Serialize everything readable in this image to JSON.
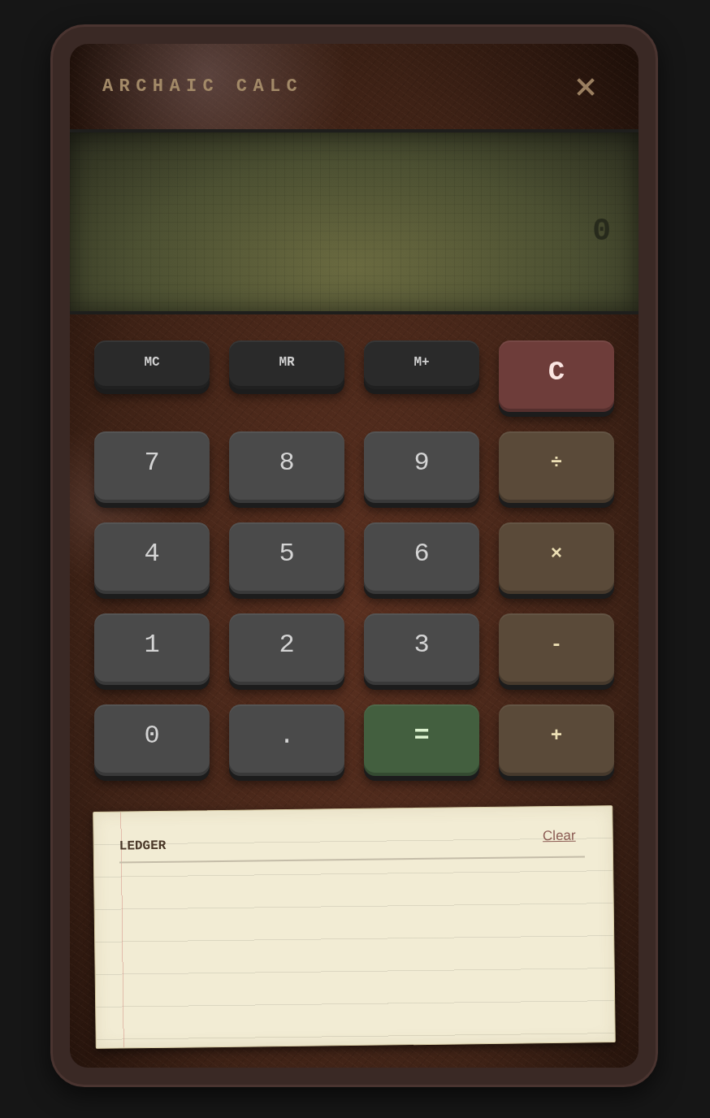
{
  "window": {
    "title": "ARCHAIC CALC"
  },
  "display": {
    "value": "0"
  },
  "keys": [
    {
      "label": "MC",
      "kind": "memory"
    },
    {
      "label": "MR",
      "kind": "memory"
    },
    {
      "label": "M+",
      "kind": "memory"
    },
    {
      "label": "C",
      "kind": "clear"
    },
    {
      "label": "7",
      "kind": "digit"
    },
    {
      "label": "8",
      "kind": "digit"
    },
    {
      "label": "9",
      "kind": "digit"
    },
    {
      "label": "÷",
      "kind": "operator"
    },
    {
      "label": "4",
      "kind": "digit"
    },
    {
      "label": "5",
      "kind": "digit"
    },
    {
      "label": "6",
      "kind": "digit"
    },
    {
      "label": "×",
      "kind": "operator"
    },
    {
      "label": "1",
      "kind": "digit"
    },
    {
      "label": "2",
      "kind": "digit"
    },
    {
      "label": "3",
      "kind": "digit"
    },
    {
      "label": "-",
      "kind": "operator"
    },
    {
      "label": "0",
      "kind": "digit"
    },
    {
      "label": ".",
      "kind": "digit"
    },
    {
      "label": "=",
      "kind": "equals"
    },
    {
      "label": "+",
      "kind": "operator"
    }
  ],
  "ledger": {
    "title": "LEDGER",
    "clear_link": "Clear"
  }
}
